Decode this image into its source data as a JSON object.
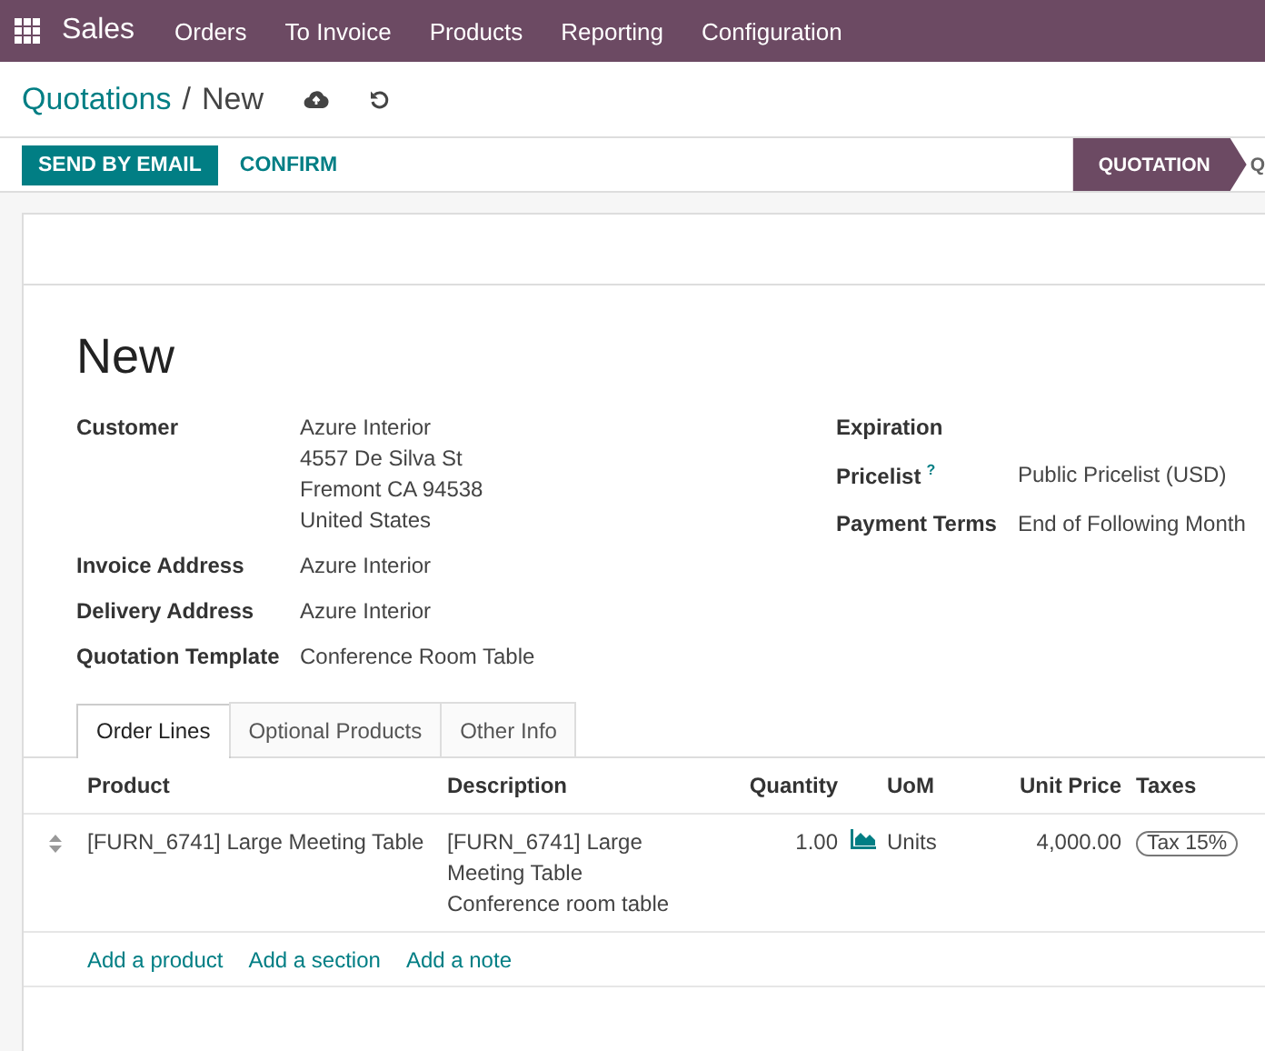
{
  "navbar": {
    "app": "Sales",
    "menu": [
      "Orders",
      "To Invoice",
      "Products",
      "Reporting",
      "Configuration"
    ]
  },
  "breadcrumb": {
    "parent": "Quotations",
    "separator": "/",
    "current": "New"
  },
  "actions": [
    {
      "label": "SEND BY EMAIL",
      "kind": "primary"
    },
    {
      "label": "CONFIRM",
      "kind": "secondary"
    }
  ],
  "status_stages": [
    {
      "label": "QUOTATION",
      "selected": true
    },
    {
      "label": "Q",
      "selected": false
    }
  ],
  "form": {
    "title": "New",
    "left_fields": [
      {
        "label": "Customer",
        "value_lines": [
          "Azure Interior",
          "4557 De Silva St",
          "Fremont CA 94538",
          "United States"
        ]
      },
      {
        "label": "Invoice Address",
        "value_lines": [
          "Azure Interior"
        ]
      },
      {
        "label": "Delivery Address",
        "value_lines": [
          "Azure Interior"
        ]
      },
      {
        "label": "Quotation Template",
        "value_lines": [
          "Conference Room Table"
        ]
      }
    ],
    "right_fields": [
      {
        "label": "Expiration"
      },
      {
        "label": "Pricelist",
        "help": "?",
        "value": "Public Pricelist (USD)"
      },
      {
        "label": "Payment Terms",
        "value": "End of Following Month"
      }
    ]
  },
  "tabs": [
    {
      "label": "Order Lines",
      "selected": true
    },
    {
      "label": "Optional Products",
      "selected": false
    },
    {
      "label": "Other Info",
      "selected": false
    }
  ],
  "order_lines": {
    "columns": [
      "Product",
      "Description",
      "Quantity",
      "UoM",
      "Unit Price",
      "Taxes"
    ],
    "rows": [
      {
        "product": "[FURN_6741] Large Meeting Table",
        "description_lines": [
          "[FURN_6741] Large",
          "Meeting Table",
          "Conference room table"
        ],
        "quantity": "1.00",
        "uom": "Units",
        "unit_price": "4,000.00",
        "taxes": [
          "Tax 15%"
        ]
      }
    ],
    "add_links": [
      "Add a product",
      "Add a section",
      "Add a note"
    ]
  }
}
